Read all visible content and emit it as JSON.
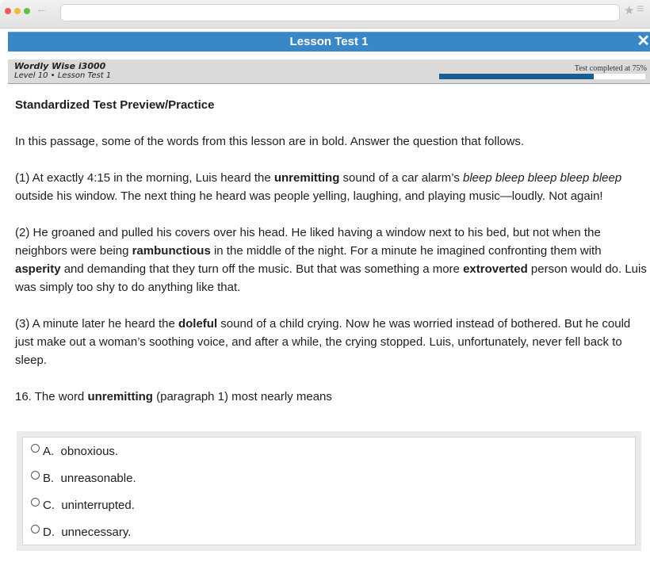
{
  "window": {
    "title": "Lesson Test 1",
    "close_icon": "close-icon"
  },
  "header": {
    "product": "Wordly Wise i3000",
    "lesson": "Level 10 • Lesson Test 1",
    "progress_label": "Test completed at 75%",
    "progress_fraction": 0.75
  },
  "colors": {
    "titlebar": "#3a87c8",
    "progress": "#195d95"
  },
  "content": {
    "heading": "Standardized Test Preview/Practice",
    "instructions": "In this passage, some of the words from this lesson are in bold. Answer the question that follows.",
    "p1": {
      "a": "(1)  At exactly 4:15 in the morning, Luis heard the ",
      "b": "unremitting",
      "c": " sound of a car alarm’s ",
      "d": "bleep bleep bleep bleep bleep",
      "e": " outside his window. The next thing he heard was people yelling, laughing, and playing music—loudly. Not again!"
    },
    "p2": {
      "a": "(2)  He groaned and pulled his covers over his head. He liked having a window next to his bed, but not when the neighbors were being ",
      "b": "rambunctious",
      "c": " in the middle of the night. For a minute he imagined confronting them with ",
      "d": "asperity",
      "e": " and demanding that they turn off the music. But that was something a more ",
      "f": "extroverted",
      "g": " person would do. Luis was simply too shy to do anything like that."
    },
    "p3": {
      "a": "(3)  A minute later he heard the ",
      "b": "doleful",
      "c": " sound of a child crying. Now he was worried instead of bothered. But he could just make out a woman’s soothing voice, and after a while, the crying stopped. Luis, unfortunately, never fell back to sleep."
    },
    "question": {
      "a": "16. The word ",
      "b": "unremitting",
      "c": " (paragraph 1) most nearly means"
    },
    "choices": [
      {
        "letter": "A.",
        "text": "obnoxious."
      },
      {
        "letter": "B.",
        "text": "unreasonable."
      },
      {
        "letter": "C.",
        "text": "uninterrupted."
      },
      {
        "letter": "D.",
        "text": "unnecessary."
      }
    ]
  }
}
